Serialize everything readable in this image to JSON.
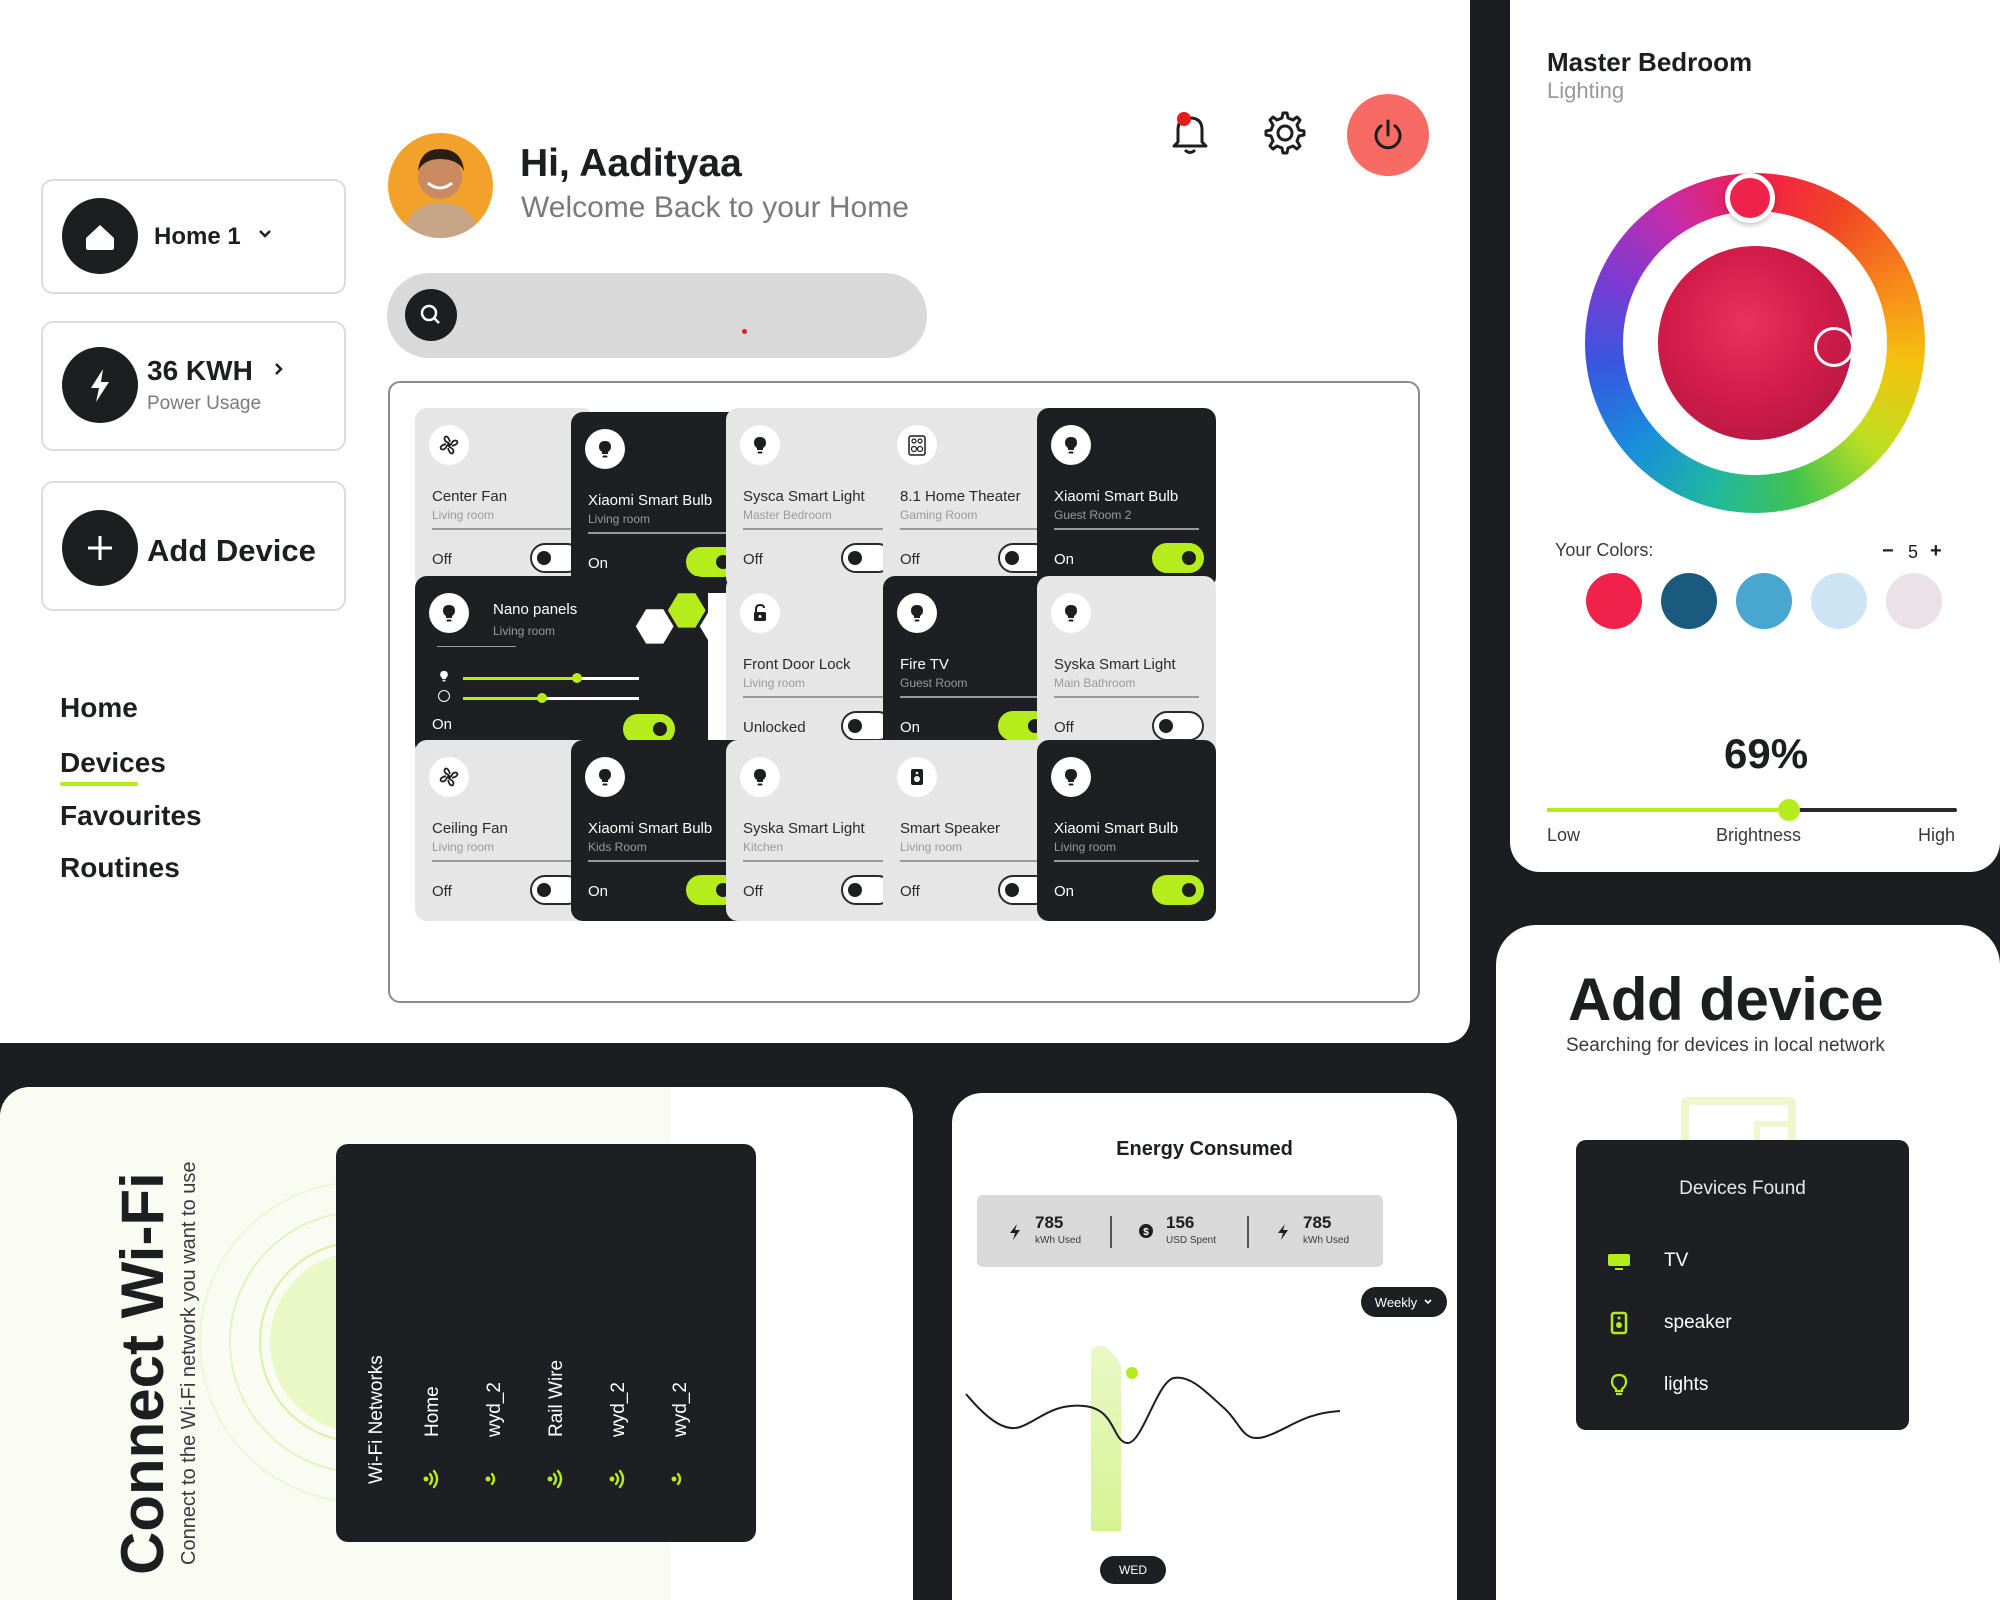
{
  "user": {
    "greeting": "Hi, Aadityaa",
    "subtitle": "Welcome Back to your Home"
  },
  "sidebar": {
    "home_selector": "Home 1",
    "power": {
      "value": "36 KWH",
      "label": "Power Usage"
    },
    "add_device": "Add Device",
    "nav": [
      "Home",
      "Devices",
      "Favourites",
      "Routines"
    ],
    "active_nav": "Devices"
  },
  "devices": [
    {
      "name": "Center Fan",
      "room": "Living room",
      "state": "Off",
      "on": false,
      "icon": "fan-icon"
    },
    {
      "name": "Xiaomi Smart Bulb",
      "room": "Living room",
      "state": "On",
      "on": true,
      "icon": "bulb-icon"
    },
    {
      "name": "Sysca Smart Light",
      "room": "Master Bedroom",
      "state": "Off",
      "on": false,
      "icon": "bulb-icon"
    },
    {
      "name": "8.1 Home Theater",
      "room": "Gaming Room",
      "state": "Off",
      "on": false,
      "icon": "theater-icon"
    },
    {
      "name": "Xiaomi Smart Bulb",
      "room": "Guest Room 2",
      "state": "On",
      "on": true,
      "icon": "bulb-icon"
    },
    {
      "name": "Nano panels",
      "room": "Living room",
      "state": "On",
      "on": true,
      "icon": "bulb-icon",
      "brightness": 0.65,
      "hue": 0.45
    },
    {
      "name": "Front Door Lock",
      "room": "Living room",
      "state": "Unlocked",
      "on": false,
      "icon": "lock-icon"
    },
    {
      "name": "Fire TV",
      "room": "Guest  Room",
      "state": "On",
      "on": true,
      "icon": "bulb-icon"
    },
    {
      "name": "Syska Smart Light",
      "room": "Main Bathroom",
      "state": "Off",
      "on": false,
      "icon": "bulb-icon"
    },
    {
      "name": "Ceiling Fan",
      "room": "Living room",
      "state": "Off",
      "on": false,
      "icon": "fan-icon"
    },
    {
      "name": "Xiaomi Smart Bulb",
      "room": "Kids Room",
      "state": "On",
      "on": true,
      "icon": "bulb-icon"
    },
    {
      "name": "Syska Smart Light",
      "room": "Kitchen",
      "state": "Off",
      "on": false,
      "icon": "bulb-icon"
    },
    {
      "name": "Smart Speaker",
      "room": "Living room",
      "state": "Off",
      "on": false,
      "icon": "speaker-icon"
    },
    {
      "name": "Xiaomi Smart Bulb",
      "room": "Living room",
      "state": "On",
      "on": true,
      "icon": "bulb-icon"
    }
  ],
  "lighting": {
    "title": "Master Bedroom",
    "subtitle": "Lighting",
    "your_colors": "Your Colors:",
    "count_minus": "−",
    "count": "5",
    "count_plus": "+",
    "colors": [
      "#f0224c",
      "#1a5a7e",
      "#48a6cf",
      "#cde4f4",
      "#ebe2e8"
    ],
    "brightness": "69%",
    "brightness_value": 0.59,
    "low": "Low",
    "label": "Brightness",
    "high": "High"
  },
  "add_device": {
    "title": "Add device",
    "subtitle": "Searching for devices in local network",
    "found_title": "Devices Found",
    "found": [
      {
        "label": "TV",
        "icon": "tv-icon"
      },
      {
        "label": "speaker",
        "icon": "speaker-icon"
      },
      {
        "label": "lights",
        "icon": "bulb-icon"
      }
    ]
  },
  "wifi": {
    "title": "Connect Wi-Fi",
    "subtitle": "Connect to the Wi-Fi network you want to use",
    "list_title": "Wi-Fi Networks",
    "networks": [
      "Home",
      "wyd_2",
      "Rail Wire",
      "wyd_2",
      "wyd_2"
    ]
  },
  "energy": {
    "title": "Energy Consumed",
    "stats": [
      {
        "value": "785",
        "label": "kWh Used",
        "icon": "bolt-icon"
      },
      {
        "value": "156",
        "label": "USD Spent",
        "icon": "dollar-icon"
      },
      {
        "value": "785",
        "label": "kWh Used",
        "icon": "bolt-icon"
      }
    ],
    "period": "Weekly",
    "selected_day": "WED"
  },
  "colors": {
    "accent": "#b5ec1c",
    "dark": "#1e1f22",
    "power_button": "#f86a64",
    "background": "#1c1d20"
  }
}
